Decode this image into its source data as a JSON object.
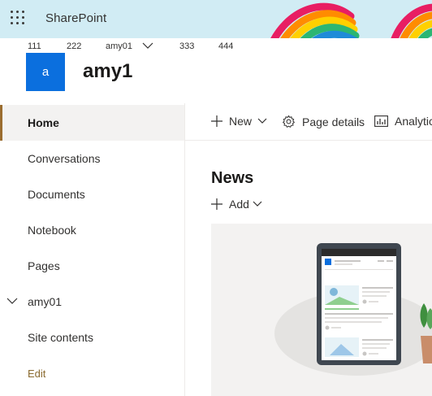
{
  "suite_bar": {
    "brand": "SharePoint",
    "accent_color": "#d1ecf4",
    "icons": {
      "app_launcher": "waffle-icon"
    }
  },
  "hub_nav": {
    "items": [
      "111",
      "222",
      "amy01",
      "333",
      "444"
    ]
  },
  "site": {
    "logo_letter": "a",
    "logo_color": "#0b6fde",
    "title": "amy1"
  },
  "left_nav": {
    "items": [
      {
        "label": "Home",
        "selected": true
      },
      {
        "label": "Conversations"
      },
      {
        "label": "Documents"
      },
      {
        "label": "Notebook"
      },
      {
        "label": "Pages"
      },
      {
        "label": "amy01",
        "expandable": true
      },
      {
        "label": "Site contents"
      }
    ],
    "edit_label": "Edit"
  },
  "command_bar": {
    "new_label": "New",
    "page_details_label": "Page details",
    "analytics_label": "Analytics"
  },
  "news": {
    "title": "News",
    "add_label": "Add"
  }
}
